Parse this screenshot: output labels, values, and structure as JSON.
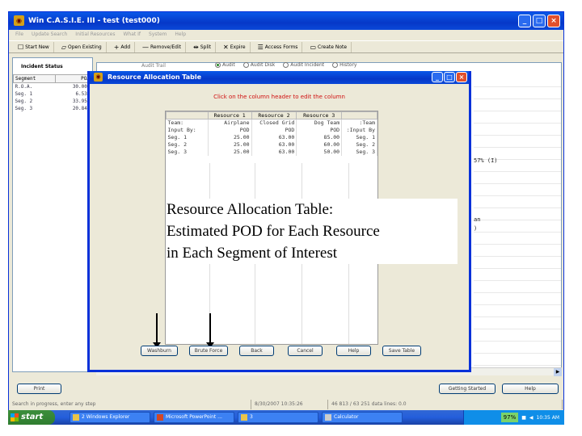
{
  "window": {
    "title": "Win C.A.S.I.E. III - test (test000)",
    "controls": [
      "_",
      "□",
      "×"
    ]
  },
  "menu": [
    "File",
    "Update Search",
    "Initial Resources",
    "What If",
    "System",
    "Help"
  ],
  "toolbar": [
    {
      "icon": "start-new-icon",
      "glyph": "☐",
      "label": "Start New"
    },
    {
      "icon": "open-icon",
      "glyph": "▱",
      "label": "Open Existing"
    },
    {
      "icon": "add-icon",
      "glyph": "+",
      "label": "Add"
    },
    {
      "icon": "remove-edit-icon",
      "glyph": "—",
      "label": "Remove/Edit"
    },
    {
      "icon": "split-icon",
      "glyph": "⇹",
      "label": "Split"
    },
    {
      "icon": "expire-icon",
      "glyph": "✕",
      "label": "Expire"
    },
    {
      "icon": "access-forms-icon",
      "glyph": "☰",
      "label": "Access Forms"
    },
    {
      "icon": "create-note-icon",
      "glyph": "▭",
      "label": "Create Note"
    }
  ],
  "incident_status": {
    "heading": "Incident Status",
    "columns": [
      "Segment",
      "POA"
    ],
    "rows": [
      {
        "segment": "R.O.A.",
        "poa": "30.00%"
      },
      {
        "segment": "Seg. 1",
        "poa": "6.53%"
      },
      {
        "segment": "Seg. 2",
        "poa": "33.95%"
      },
      {
        "segment": "Seg. 3",
        "poa": "20.84%"
      }
    ]
  },
  "audit": {
    "label": "Audit Trail",
    "options": [
      "Audit",
      "Audit Disk",
      "Audit Incident",
      "History"
    ],
    "selected": 0
  },
  "peek": {
    "line1": "57% (I)",
    "line2": "an",
    "line3": ")"
  },
  "bottom_buttons": {
    "print": "Print",
    "getting_started": "Getting Started",
    "help": "Help"
  },
  "status": [
    "Search in progress, enter any step",
    "8/30/2007 10:35:26",
    "46 813 / 63 251 data lines: 0.0"
  ],
  "taskbar": {
    "start": "start",
    "tasks": [
      "2 Windows Explorer",
      "Microsoft PowerPoint ...",
      "3",
      "Calculator"
    ],
    "battery": "97%",
    "clock": "10:35 AM"
  },
  "dialog": {
    "title": "Resource Allocation Table",
    "instruction": "Click on the column header to edit the column",
    "headers": [
      "",
      "Resource 1",
      "Resource 2",
      "Resource 3",
      ""
    ],
    "rows": [
      [
        "Team:",
        "Airplane",
        "Closed Grid",
        "Dog Team",
        ":Team"
      ],
      [
        "Input By:",
        "POD",
        "POD",
        "POD",
        ":Input By"
      ],
      [
        "Seg. 1",
        "25.00",
        "63.00",
        "85.00",
        "Seg. 1"
      ],
      [
        "Seg. 2",
        "25.00",
        "63.00",
        "60.00",
        "Seg. 2"
      ],
      [
        "Seg. 3",
        "25.00",
        "63.00",
        "50.00",
        "Seg. 3"
      ]
    ],
    "buttons": {
      "washburn": "Washburn",
      "brute_force": "Brute Force",
      "back": "Back",
      "cancel": "Cancel",
      "help": "Help",
      "save_table": "Save Table"
    }
  },
  "caption": {
    "line1": "Resource Allocation Table:",
    "line2": "Estimated POD for Each Resource",
    "line3": "in Each Segment of Interest"
  }
}
